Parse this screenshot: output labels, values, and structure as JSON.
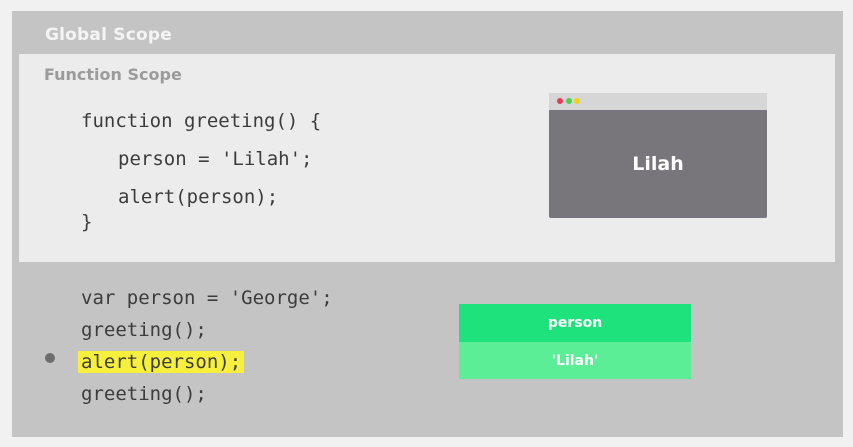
{
  "global_scope": {
    "title": "Global Scope",
    "code": {
      "line1": "var person = 'George';",
      "line2": "greeting();",
      "line3": "alert(person);",
      "line4": "greeting();"
    }
  },
  "function_scope": {
    "title": "Function Scope",
    "code": {
      "line1": "function greeting() {",
      "line2": "person = 'Lilah';",
      "line3": "alert(person);",
      "line4": "}"
    }
  },
  "browser_window": {
    "content": "Lilah"
  },
  "variable_box": {
    "name": "person",
    "value": "'Lilah'"
  },
  "colors": {
    "global_background": "#c4c4c4",
    "function_background": "#ececec",
    "highlight": "#f6ef3c",
    "variable_name_bg": "#1ee27c",
    "variable_value_bg": "#5ced97",
    "browser_bg": "#78767a"
  }
}
